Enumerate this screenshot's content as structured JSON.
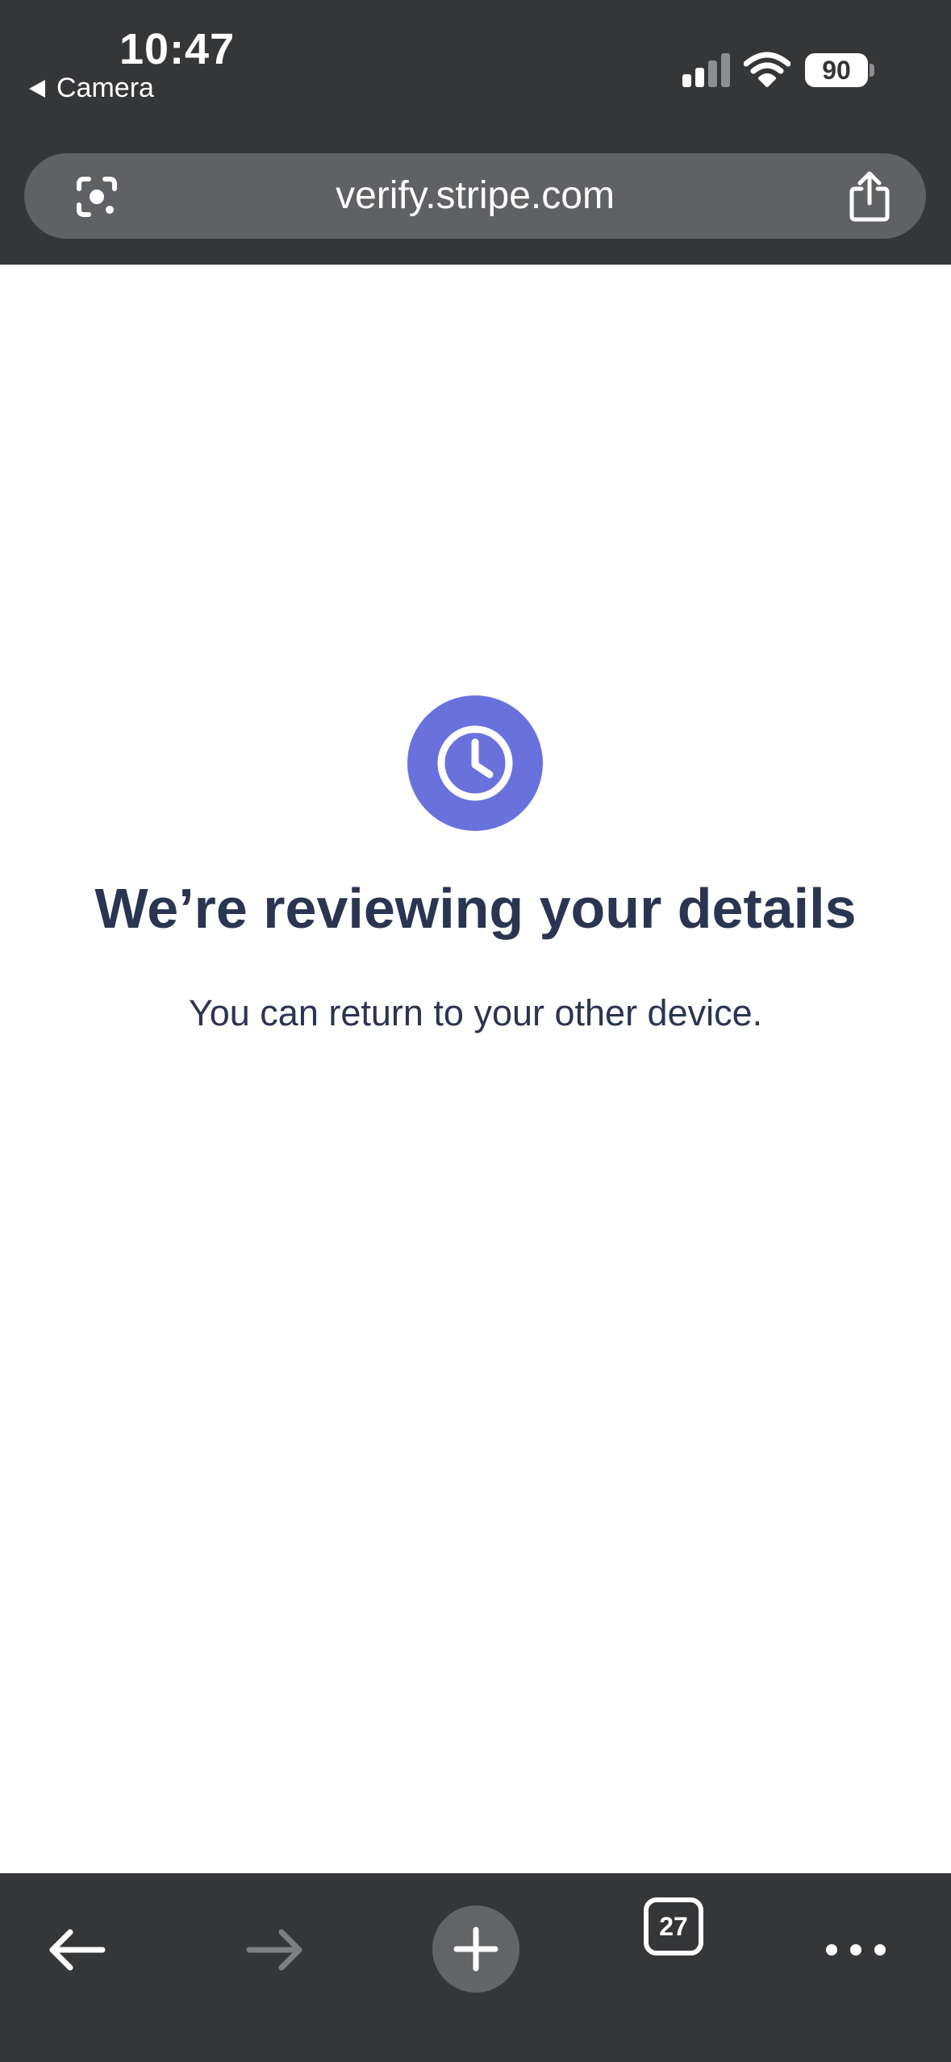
{
  "status_bar": {
    "time": "10:47",
    "back_app_label": "Camera",
    "battery_level": "90",
    "signal_bars_active": 2,
    "signal_bars_total": 4
  },
  "browser": {
    "url": "verify.stripe.com",
    "lens_icon": "lens-icon",
    "share_icon": "share-icon"
  },
  "page": {
    "icon": "clock-icon",
    "icon_color": "#6972dc",
    "headline": "We’re reviewing your details",
    "subtext": "You can return to your other device.",
    "text_color": "#2a3551"
  },
  "toolbar": {
    "back_icon": "arrow-left-icon",
    "forward_icon": "arrow-right-icon",
    "new_tab_icon": "plus-icon",
    "tab_count": "27",
    "more_icon": "more-dots-icon"
  },
  "colors": {
    "chrome_background": "#353638",
    "url_bar_background": "#5f6165"
  }
}
